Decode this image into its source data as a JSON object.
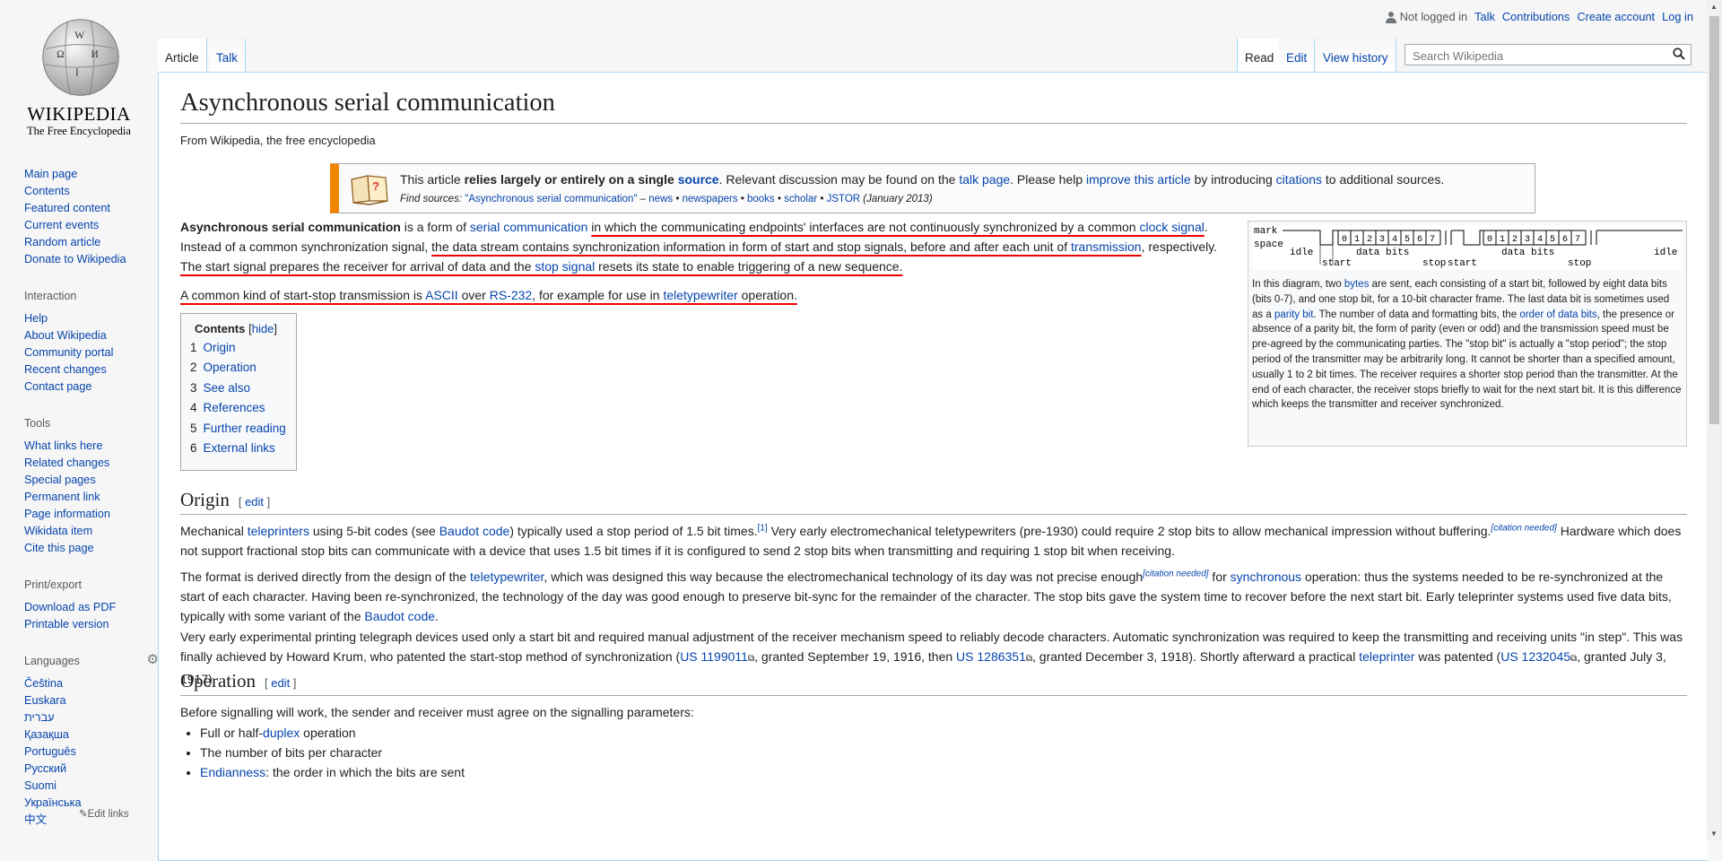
{
  "logo": {
    "wordmark": "WIKIPEDIA",
    "tagline": "The Free Encyclopedia"
  },
  "sidebar": {
    "nav": [
      "Main page",
      "Contents",
      "Featured content",
      "Current events",
      "Random article",
      "Donate to Wikipedia"
    ],
    "interaction_heading": "Interaction",
    "interaction": [
      "Help",
      "About Wikipedia",
      "Community portal",
      "Recent changes",
      "Contact page"
    ],
    "tools_heading": "Tools",
    "tools": [
      "What links here",
      "Related changes",
      "Special pages",
      "Permanent link",
      "Page information",
      "Wikidata item",
      "Cite this page"
    ],
    "print_heading": "Print/export",
    "print": [
      "Download as PDF",
      "Printable version"
    ],
    "languages_heading": "Languages",
    "languages": [
      "Čeština",
      "Euskara",
      "עברית",
      "Қазақша",
      "Português",
      "Русский",
      "Suomi",
      "Українська",
      "中文"
    ],
    "edit_links": "Edit links"
  },
  "personal": {
    "not_logged_in": "Not logged in",
    "talk": "Talk",
    "contributions": "Contributions",
    "create_account": "Create account",
    "log_in": "Log in"
  },
  "tabs": {
    "article": "Article",
    "talk": "Talk",
    "read": "Read",
    "edit": "Edit",
    "view_history": "View history"
  },
  "search": {
    "placeholder": "Search Wikipedia"
  },
  "page": {
    "title": "Asynchronous serial communication",
    "site_sub": "From Wikipedia, the free encyclopedia"
  },
  "ambox": {
    "t1": "This article ",
    "t2": "relies largely or entirely on a single ",
    "t3": "source",
    "t4": ". Relevant discussion may be found on the ",
    "t5": "talk page",
    "t6": ". Please help ",
    "t7": "improve this article",
    "t8": " by introducing ",
    "t9": "citations",
    "t10": " to additional sources.",
    "find": "Find sources: ",
    "find_query": "\"Asynchronous serial communication\"",
    "dash": " – ",
    "news": "news",
    "newspapers": "newspapers",
    "books": "books",
    "scholar": "scholar",
    "jstor": "JSTOR",
    "sep": " • ",
    "date": " (January 2013)"
  },
  "lead": {
    "b": "Asynchronous serial communication",
    "a1": " is a form of ",
    "l1": "serial communication",
    "a2": " ",
    "u1": "in which the communicating endpoints' interfaces are not continuously synchronized by a common ",
    "l2": "clock signal",
    "a3": ". Instead of a common synchronization signal, ",
    "u2": "the data stream contains synchronization information in form of start and stop signals, before and after each unit of ",
    "l3": "transmission",
    "a4": ", respectively. ",
    "u3a": "The start signal prepares the receiver for arrival of data and the ",
    "l4": "stop signal",
    "u3b": " resets its state to enable triggering of a new sequence.",
    "p2a": "A common kind of start-stop transmission is ",
    "p2l1": "ASCII",
    "p2b": " over ",
    "p2l2": "RS-232",
    "p2c": ", for example for use in ",
    "p2l3": "teletypewriter",
    "p2d": " operation."
  },
  "diagram": {
    "mark": "mark",
    "space": "space",
    "idle": "idle",
    "data_bits": "data bits",
    "start": "start",
    "stop": "stop",
    "bits": [
      "0",
      "1",
      "2",
      "3",
      "4",
      "5",
      "6",
      "7"
    ]
  },
  "caption": {
    "c1": "In this diagram, two ",
    "c2": "bytes",
    "c3": " are sent, each consisting of a start bit, followed by eight data bits (bits 0-7), and one stop bit, for a 10-bit character frame. The last data bit is sometimes used as a ",
    "c4": "parity bit",
    "c5": ". The number of data and formatting bits, the ",
    "c6": "order of data bits",
    "c7": ", the presence or absence of a parity bit, the form of parity (even or odd) and the transmission speed must be pre-agreed by the communicating parties. The \"stop bit\" is actually a \"stop period\"; the stop period of the transmitter may be arbitrarily long. It cannot be shorter than a specified amount, usually 1 to 2 bit times. The receiver requires a shorter stop period than the transmitter. At the end of each character, the receiver stops briefly to wait for the next start bit. It is this difference which keeps the transmitter and receiver synchronized."
  },
  "toc": {
    "title": "Contents",
    "hide": "hide",
    "items": [
      {
        "num": "1",
        "label": "Origin"
      },
      {
        "num": "2",
        "label": "Operation"
      },
      {
        "num": "3",
        "label": "See also"
      },
      {
        "num": "4",
        "label": "References"
      },
      {
        "num": "5",
        "label": "Further reading"
      },
      {
        "num": "6",
        "label": "External links"
      }
    ]
  },
  "origin": {
    "heading": "Origin",
    "edit": "edit",
    "p1a": "Mechanical ",
    "p1l1": "teleprinters",
    "p1b": " using 5-bit codes (see ",
    "p1l2": "Baudot code",
    "p1c": ") typically used a stop period of 1.5 bit times.",
    "p1ref": "[1]",
    "p1d": " Very early electromechanical teletypewriters (pre-1930) could require 2 stop bits to allow mechanical impression without buffering.",
    "p1cn": "[citation needed]",
    "p1e": " Hardware which does not support fractional stop bits can communicate with a device that uses 1.5 bit times if it is configured to send 2 stop bits when transmitting and requiring 1 stop bit when receiving.",
    "p2a": "The format is derived directly from the design of the ",
    "p2l1": "teletypewriter",
    "p2b": ", which was designed this way because the electromechanical technology of its day was not precise enough",
    "p2cn": "[citation needed]",
    "p2c": " for ",
    "p2l2": "synchronous",
    "p2d": " operation: thus the systems needed to be re-synchronized at the start of each character. Having been re-synchronized, the technology of the day was good enough to preserve bit-sync for the remainder of the character. The stop bits gave the system time to recover before the next start bit. Early teleprinter systems used five data bits, typically with some variant of the ",
    "p2l3": "Baudot code",
    "p2e": ".",
    "p3a": "Very early experimental printing telegraph devices used only a start bit and required manual adjustment of the receiver mechanism speed to reliably decode characters. Automatic synchronization was required to keep the transmitting and receiving units \"in step\". This was finally achieved by Howard Krum, who patented the start-stop method of synchronization (",
    "p3l1": "US 1199011",
    "p3b": ", granted September 19, 1916, then ",
    "p3l2": "US 1286351",
    "p3c": ", granted December 3, 1918). Shortly afterward a practical ",
    "p3l3": "teleprinter",
    "p3d": " was patented (",
    "p3l4": "US 1232045",
    "p3e": ", granted July 3, 1917)."
  },
  "operation": {
    "heading": "Operation",
    "edit": "edit",
    "intro": "Before signalling will work, the sender and receiver must agree on the signalling parameters:",
    "b1a": "Full or half-",
    "b1l": "duplex",
    "b1b": " operation",
    "b2": "The number of bits per character",
    "b3l": "Endianness",
    "b3b": ": the order in which the bits are sent"
  }
}
